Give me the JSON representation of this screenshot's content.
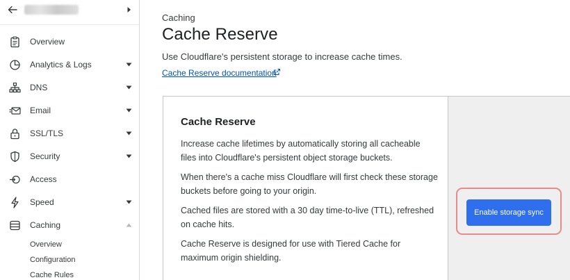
{
  "sidebar": {
    "items": [
      {
        "key": "overview",
        "label": "Overview",
        "icon": "clipboard-icon",
        "caret": "none"
      },
      {
        "key": "analytics",
        "label": "Analytics & Logs",
        "icon": "pie-chart-icon",
        "caret": "down"
      },
      {
        "key": "dns",
        "label": "DNS",
        "icon": "network-icon",
        "caret": "down"
      },
      {
        "key": "email",
        "label": "Email",
        "icon": "envelope-icon",
        "caret": "down"
      },
      {
        "key": "ssl",
        "label": "SSL/TLS",
        "icon": "lock-icon",
        "caret": "down"
      },
      {
        "key": "security",
        "label": "Security",
        "icon": "shield-icon",
        "caret": "down"
      },
      {
        "key": "access",
        "label": "Access",
        "icon": "access-icon",
        "caret": "none"
      },
      {
        "key": "speed",
        "label": "Speed",
        "icon": "lightning-icon",
        "caret": "down"
      },
      {
        "key": "caching",
        "label": "Caching",
        "icon": "database-icon",
        "caret": "up"
      }
    ],
    "caching_subitems": [
      "Overview",
      "Configuration",
      "Cache Rules"
    ]
  },
  "main": {
    "eyebrow": "Caching",
    "title": "Cache Reserve",
    "description": "Use Cloudflare's persistent storage to increase cache times.",
    "doc_link": "Cache Reserve documentation",
    "card": {
      "title": "Cache Reserve",
      "paragraphs": [
        "Increase cache lifetimes by automatically storing all cacheable files into Cloudflare's persistent object storage buckets.",
        "When there's a cache miss Cloudflare will first check these storage buckets before going to your origin.",
        "Cached files are stored with a 30 day time-to-live (TTL), refreshed on cache hits.",
        "Cache Reserve is designed for use with Tiered Cache for maximum origin shielding."
      ],
      "button_label": "Enable storage sync"
    }
  },
  "colors": {
    "accent": "#2f6fed",
    "link": "#0051c3",
    "highlight": "#e88a8a",
    "side_panel": "#efefef"
  }
}
